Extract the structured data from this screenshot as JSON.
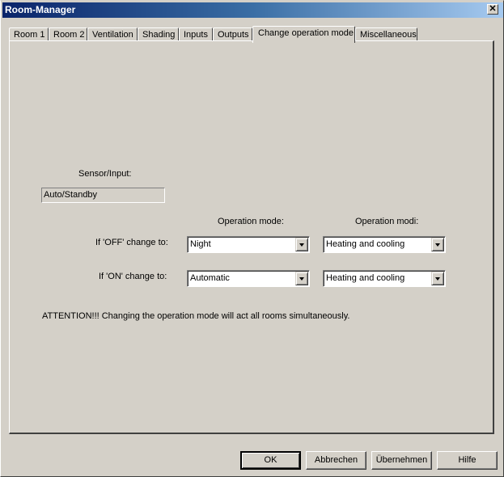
{
  "window": {
    "title": "Room-Manager",
    "close_label": "✕"
  },
  "tabs": [
    {
      "label": "Room 1"
    },
    {
      "label": "Room 2"
    },
    {
      "label": "Ventilation"
    },
    {
      "label": "Shading"
    },
    {
      "label": "Inputs"
    },
    {
      "label": "Outputs"
    },
    {
      "label": "Change operation mode",
      "active": true
    },
    {
      "label": "Miscellaneous"
    }
  ],
  "panel": {
    "sensor_label": "Sensor/Input:",
    "sensor_value": "Auto/Standby",
    "col_mode_header": "Operation mode:",
    "col_modi_header": "Operation modi:",
    "off_label": "If 'OFF' change to:",
    "on_label": "If 'ON' change to:",
    "off_mode": "Night",
    "off_modi": "Heating and cooling",
    "on_mode": "Automatic",
    "on_modi": "Heating and cooling",
    "attention": "ATTENTION!!! Changing the operation mode will act all rooms simultaneously."
  },
  "buttons": {
    "ok": "OK",
    "cancel": "Abbrechen",
    "apply": "Übernehmen",
    "help": "Hilfe"
  }
}
